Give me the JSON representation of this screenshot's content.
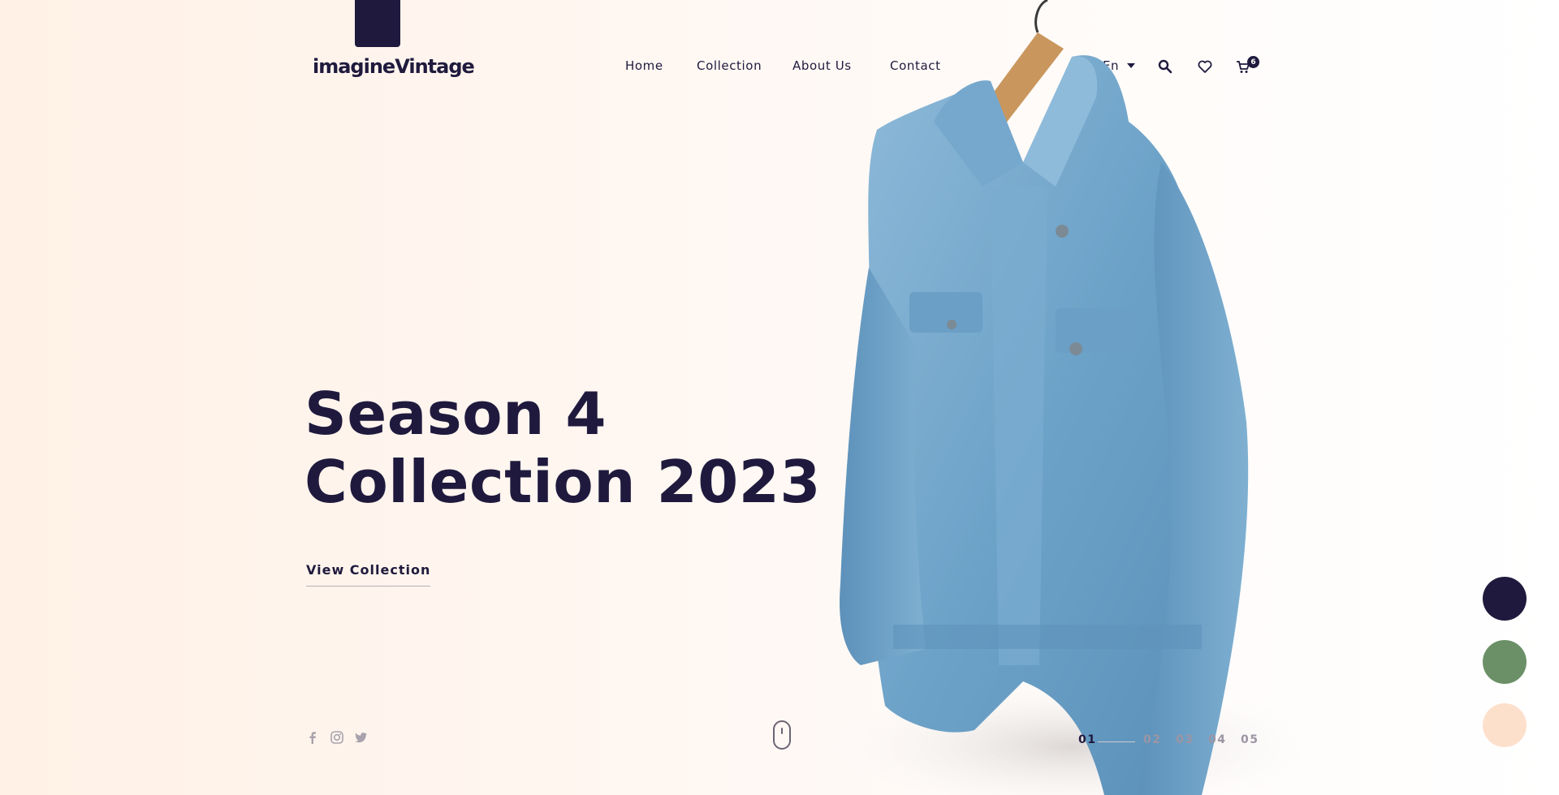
{
  "brand": {
    "logo_text": "imagineVintage",
    "accent": "#1f1a3d"
  },
  "nav": {
    "items": [
      {
        "label": "Home"
      },
      {
        "label": "Collection"
      },
      {
        "label": "About Us"
      },
      {
        "label": "Contact"
      }
    ]
  },
  "header": {
    "language": "En",
    "icons": [
      "search-icon",
      "heart-icon",
      "cart-icon"
    ],
    "cart_count": "6"
  },
  "hero": {
    "title_line1": "Season 4",
    "title_line2": "Collection 2023",
    "cta_label": "View Collection"
  },
  "social": {
    "icons": [
      "facebook-icon",
      "instagram-icon",
      "twitter-icon"
    ]
  },
  "pagination": {
    "pages": [
      "01",
      "02",
      "03",
      "04",
      "05"
    ],
    "active": "01"
  },
  "swatches": {
    "colors": [
      "#1f1a3d",
      "#6b9068",
      "#fde0cc"
    ]
  }
}
